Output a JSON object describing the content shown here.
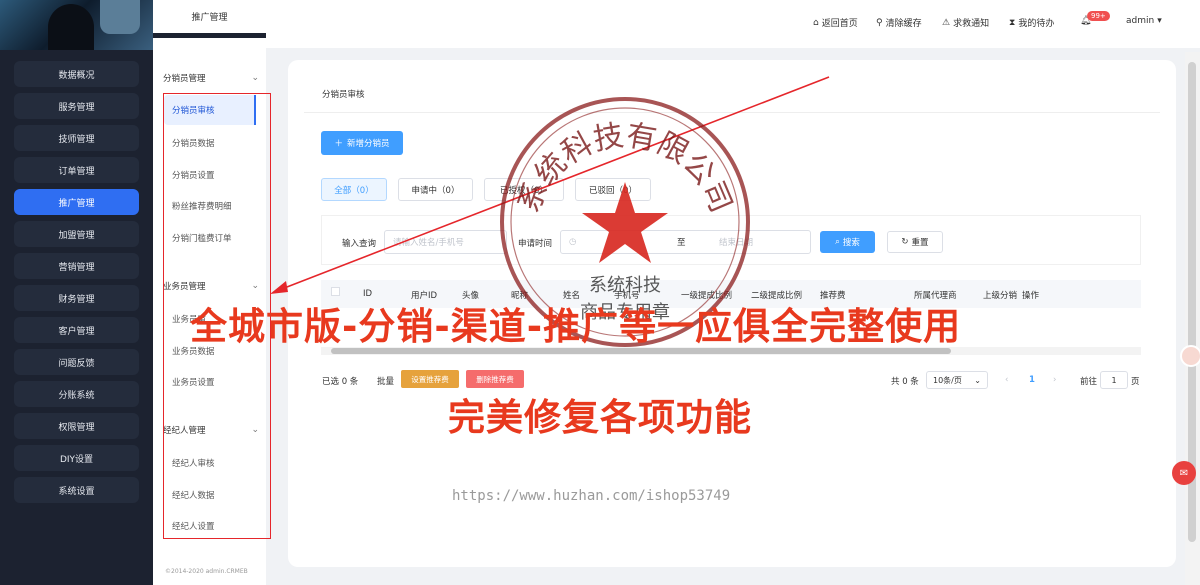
{
  "left_nav": {
    "items": [
      {
        "label": "数据概况",
        "active": false
      },
      {
        "label": "服务管理",
        "active": false
      },
      {
        "label": "技师管理",
        "active": false
      },
      {
        "label": "订单管理",
        "active": false
      },
      {
        "label": "推广管理",
        "active": true
      },
      {
        "label": "加盟管理",
        "active": false
      },
      {
        "label": "营销管理",
        "active": false
      },
      {
        "label": "财务管理",
        "active": false
      },
      {
        "label": "客户管理",
        "active": false
      },
      {
        "label": "问题反馈",
        "active": false
      },
      {
        "label": "分账系统",
        "active": false
      },
      {
        "label": "权限管理",
        "active": false
      },
      {
        "label": "DIY设置",
        "active": false
      },
      {
        "label": "系统设置",
        "active": false
      }
    ]
  },
  "sub_nav": {
    "title": "推广管理",
    "groups": [
      {
        "label": "分销员管理",
        "items": [
          "分销员审核",
          "分销员数据",
          "分销员设置",
          "粉丝推荐费明细",
          "分销门槛费订单"
        ]
      },
      {
        "label": "业务员管理",
        "items": [
          "业务员审",
          "业务员数据",
          "业务员设置"
        ]
      },
      {
        "label": "经纪人管理",
        "items": [
          "经纪人审核",
          "经纪人数据",
          "经纪人设置"
        ]
      }
    ],
    "active_item": "分销员审核",
    "bottom_text": "©2014-2020 admin.CRMEB"
  },
  "header": {
    "home": "返回首页",
    "clear_cache": "清除缓存",
    "rescue": "求救通知",
    "todo": "我的待办",
    "badge": "99+",
    "user": "admin"
  },
  "main": {
    "breadcrumb": "分销员审核",
    "add_button": "新增分销员",
    "tabs": [
      "全部（0）",
      "申请中（0）",
      "已授权（0）",
      "已驳回（0）"
    ],
    "filter": {
      "query_label": "输入查询",
      "query_placeholder": "请输入姓名/手机号",
      "time_label": "申请时间",
      "range_sep": "至",
      "end_placeholder": "结束日期",
      "search_button": "搜索",
      "reset_button": "重置"
    },
    "table_headers": [
      "ID",
      "用户ID",
      "头像",
      "昵称",
      "姓名",
      "手机号",
      "一级提成比例",
      "二级提成比例",
      "推荐费",
      "所属代理商",
      "上级分销",
      "操作"
    ],
    "footer": {
      "selected": "已选 0 条",
      "batch": "批量",
      "set_fee": "设置推荐费",
      "delete_fee": "删除推荐费",
      "total": "共 0 条",
      "page_size": "10条/页",
      "current_page": "1",
      "goto": "前往",
      "goto_page": "1",
      "page_unit": "页"
    }
  },
  "watermark": {
    "seal_top": "系统科技有限公司",
    "seal_middle": "系统科技",
    "seal_bottom": "商品专用章",
    "line1": "全城市版-分销-渠道-推广等一应俱全完整使用",
    "line2": "完美修复各项功能",
    "url": "https://www.huzhan.com/ishop53749"
  },
  "colors": {
    "primary": "#409eff",
    "nav_active": "#2f6ef2",
    "nav_bg": "#1c2230",
    "watermark_red": "#e8391e",
    "set_fee_btn": "#e6a23c",
    "delete_fee_btn": "#f56c6c"
  }
}
